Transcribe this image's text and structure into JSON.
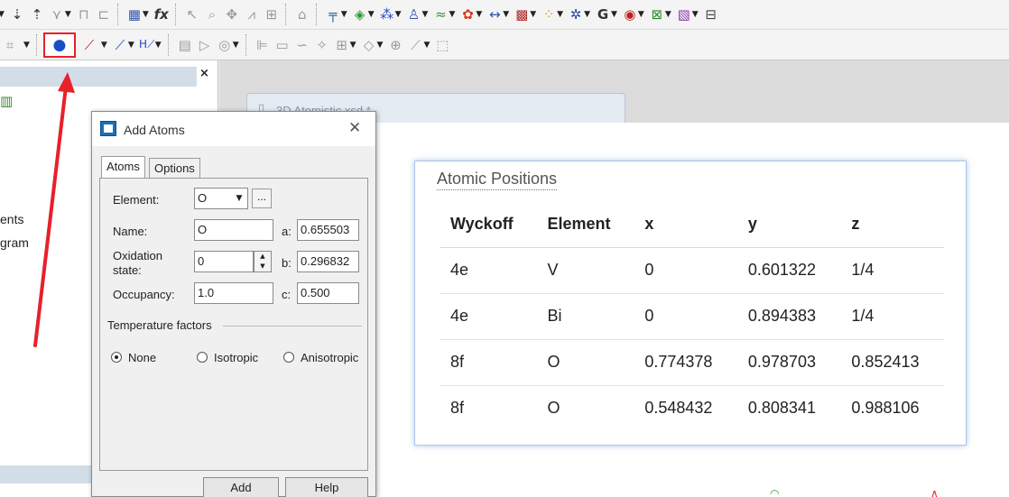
{
  "toolbar1": {
    "buttons": [
      "sort-desc-icon",
      "sort-asc-icon",
      "filter-icon",
      "lock-icon",
      "unlock-icon",
      "matrix-icon",
      "function-icon",
      "pointer-icon",
      "zoom-icon",
      "move-icon",
      "peak-icon",
      "pick-icon",
      "home-icon"
    ]
  },
  "toolbar2": {
    "add_atoms_tooltip": "Add Atoms"
  },
  "left_panel": {
    "close_glyph": "×",
    "tree_items": [
      "ents",
      "gram"
    ]
  },
  "document": {
    "tab_label": "3D Atomistic.xsd *"
  },
  "dialog": {
    "title": "Add Atoms",
    "close_glyph": "✕",
    "tabs": [
      "Atoms",
      "Options"
    ],
    "element_label": "Element:",
    "element_value": "O",
    "browse_label": "...",
    "name_label": "Name:",
    "name_value": "O",
    "oxidation_label": "Oxidation",
    "oxidation_label2": "state:",
    "oxidation_value": "0",
    "occupancy_label": "Occupancy:",
    "occupancy_value": "1.0",
    "a_label": "a:",
    "a_value": "0.655503",
    "b_label": "b:",
    "b_value": "0.296832",
    "c_label": "c:",
    "c_value": "0.500",
    "temp_label": "Temperature factors",
    "radio_none": "None",
    "radio_iso": "Isotropic",
    "radio_aniso": "Anisotropic",
    "add_button": "Add",
    "help_button": "Help"
  },
  "atomic_positions": {
    "title": "Atomic Positions",
    "headers": [
      "Wyckoff",
      "Element",
      "x",
      "y",
      "z"
    ],
    "rows": [
      [
        "4e",
        "V",
        "0",
        "0.601322",
        "1/4"
      ],
      [
        "4e",
        "Bi",
        "0",
        "0.894383",
        "1/4"
      ],
      [
        "8f",
        "O",
        "0.774378",
        "0.978703",
        "0.852413"
      ],
      [
        "8f",
        "O",
        "0.548432",
        "0.808341",
        "0.988106"
      ]
    ]
  },
  "colors": {
    "arrow": "#e8202a",
    "highlight": "#e8202a",
    "card_border": "#a9c7ea"
  }
}
